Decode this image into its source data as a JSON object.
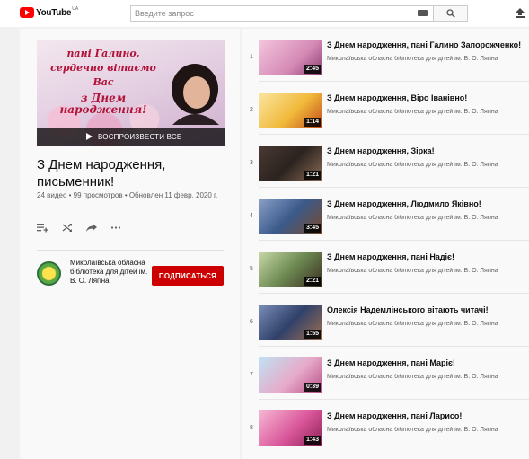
{
  "header": {
    "logo_text": "YouTube",
    "logo_region": "UA",
    "search_placeholder": "Введите запрос"
  },
  "playlist": {
    "hero_lines": [
      "пані Галино,",
      "сердечно вітаємо",
      "Вас",
      "з Днем народження!"
    ],
    "play_all_label": "ВОСПРОИЗВЕСТИ ВСЕ",
    "title": "З Днем народження, письменник!",
    "stats": "24 видео • 99 просмотров • Обновлен 11 февр. 2020 г.",
    "owner_name": "Миколаївська обласна бібліотека для дітей ім. В. О. Лягіна",
    "subscribe_label": "ПОДПИСАТЬСЯ"
  },
  "videos": [
    {
      "index": "1",
      "title": "З Днем народження, пані Галино Запорожченко!",
      "channel": "Миколаївська обласна бібліотека для дітей ім. В. О. Лягіна",
      "duration": "2:45"
    },
    {
      "index": "2",
      "title": "З Днем народження, Віро Іванівно!",
      "channel": "Миколаївська обласна бібліотека для дітей ім. В. О. Лягіна",
      "duration": "1:14"
    },
    {
      "index": "3",
      "title": "З Днем народження, Зірка!",
      "channel": "Миколаївська обласна бібліотека для дітей ім. В. О. Лягіна",
      "duration": "1:21"
    },
    {
      "index": "4",
      "title": "З Днем народження, Людмило Яківно!",
      "channel": "Миколаївська обласна бібліотека для дітей ім. В. О. Лягіна",
      "duration": "3:45"
    },
    {
      "index": "5",
      "title": "З Днем народження, пані Надіє!",
      "channel": "Миколаївська обласна бібліотека для дітей ім. В. О. Лягіна",
      "duration": "2:21"
    },
    {
      "index": "6",
      "title": "Олексія Надемлінського вітають читачі!",
      "channel": "Миколаївська обласна бібліотека для дітей ім. В. О. Лягіна",
      "duration": "1:55"
    },
    {
      "index": "7",
      "title": "З Днем народження, пані Маріє!",
      "channel": "Миколаївська обласна бібліотека для дітей ім. В. О. Лягіна",
      "duration": "0:39"
    },
    {
      "index": "8",
      "title": "З Днем народження, пані Ларисо!",
      "channel": "Миколаївська обласна бібліотека для дітей ім. В. О. Лягіна",
      "duration": "1:43"
    }
  ],
  "colors": {
    "brand_red": "#ff0000",
    "subscribe_red": "#cc0000",
    "thumb_backgrounds": [
      "#d58ab6",
      "#f0b93a",
      "#2b2320",
      "#3b5a8a",
      "#6d8a52",
      "#30416a",
      "#e7a9c9",
      "#d9569a"
    ]
  },
  "icons": {
    "toolbar": [
      "add-to-queue-icon",
      "shuffle-icon",
      "share-icon",
      "more-icon"
    ],
    "header": [
      "keyboard-icon",
      "search-icon",
      "upload-icon"
    ]
  }
}
